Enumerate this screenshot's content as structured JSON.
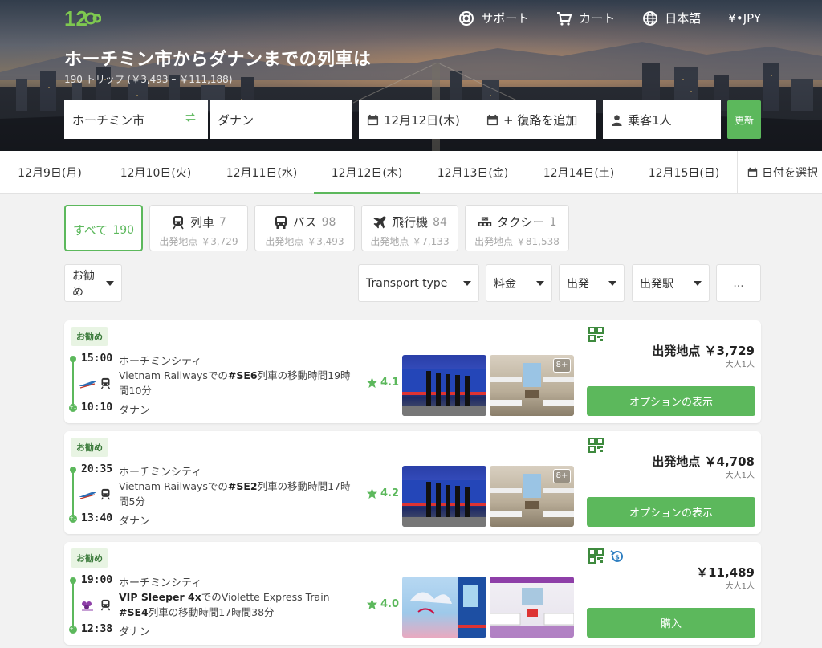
{
  "nav": {
    "support": "サポート",
    "cart": "カート",
    "language": "日本語",
    "currency": "¥•JPY"
  },
  "hero": {
    "title": "ホーチミン市からダナンまでの列車は",
    "subtitle": "190 トリップ (￥3,493 – ￥111,188)"
  },
  "search": {
    "from": "ホーチミン市",
    "to": "ダナン",
    "date": "12月12日(木)",
    "return": "+ 復路を追加",
    "passengers": "乗客1人",
    "update": "更新"
  },
  "dates": {
    "items": [
      "12月9日(月)",
      "12月10日(火)",
      "12月11日(水)",
      "12月12日(木)",
      "12月13日(金)",
      "12月14日(土)",
      "12月15日(日)"
    ],
    "active_index": 3,
    "pick": "日付を選択"
  },
  "modes": [
    {
      "label": "すべて",
      "count": "190",
      "from": ""
    },
    {
      "label": "列車",
      "count": "7",
      "from": "出発地点 ￥3,729"
    },
    {
      "label": "バス",
      "count": "98",
      "from": "出発地点 ￥3,493"
    },
    {
      "label": "飛行機",
      "count": "84",
      "from": "出発地点 ￥7,133"
    },
    {
      "label": "タクシー",
      "count": "1",
      "from": "出発地点 ￥81,538"
    }
  ],
  "filters": {
    "sort": "お勧め",
    "transport_type": "Transport type",
    "price": "料金",
    "departure": "出発",
    "station": "出発駅",
    "more": "..."
  },
  "results": [
    {
      "badge": "お勧め",
      "dep_time": "15:00",
      "dep_station": "ホーチミンシティ",
      "arr_time": "10:10",
      "arr_station": "ダナン",
      "desc_pre": "Vietnam Railwaysでの",
      "desc_code": "#SE6",
      "desc_post": "列車の移動時間19時間10分",
      "rating": "4.1",
      "more_photos": "8+",
      "price": "出発地点 ￥3,729",
      "pax": "大人1人",
      "button": "オプションの表示"
    },
    {
      "badge": "お勧め",
      "dep_time": "20:35",
      "dep_station": "ホーチミンシティ",
      "arr_time": "13:40",
      "arr_station": "ダナン",
      "desc_pre": "Vietnam Railwaysでの",
      "desc_code": "#SE2",
      "desc_post": "列車の移動時間17時間5分",
      "rating": "4.2",
      "more_photos": "8+",
      "price": "出発地点 ￥4,708",
      "pax": "大人1人",
      "button": "オプションの表示"
    },
    {
      "badge": "お勧め",
      "dep_time": "19:00",
      "dep_station": "ホーチミンシティ",
      "arr_time": "12:38",
      "arr_station": "ダナン",
      "desc_pre": "VIP Sleeper 4x",
      "desc_mid": "でのViolette Express Train ",
      "desc_code": "#SE4",
      "desc_post": "列車の移動時間17時間38分",
      "rating": "4.0",
      "more_photos": "",
      "price": "￥11,489",
      "pax": "大人1人",
      "button": "購入"
    }
  ],
  "colors": {
    "accent": "#5cb85c",
    "background": "#f2f2f2"
  }
}
